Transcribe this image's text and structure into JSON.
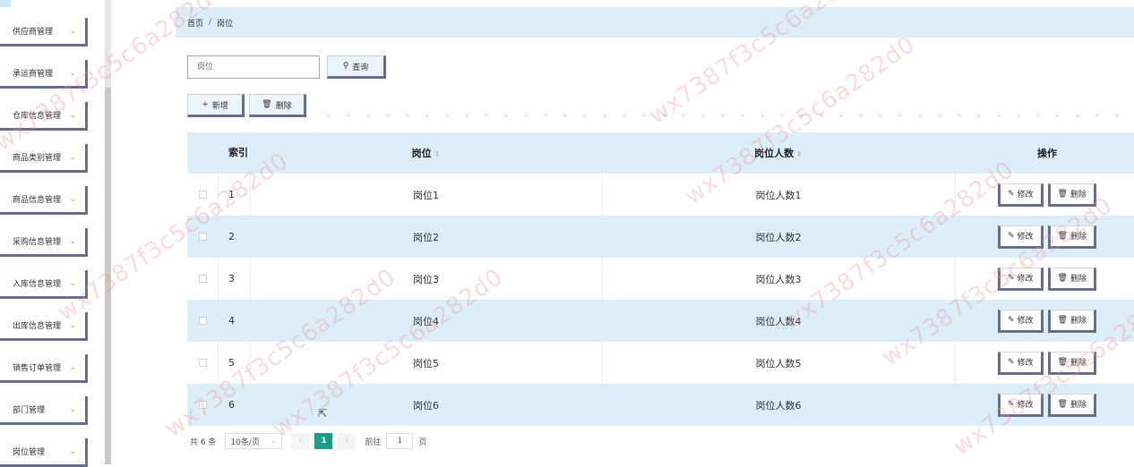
{
  "sidebar": {
    "items": [
      {
        "label": "供应商管理"
      },
      {
        "label": "承运商管理"
      },
      {
        "label": "仓库信息管理"
      },
      {
        "label": "商品类别管理"
      },
      {
        "label": "商品信息管理"
      },
      {
        "label": "采购信息管理"
      },
      {
        "label": "入库信息管理"
      },
      {
        "label": "出库信息管理"
      },
      {
        "label": "销售订单管理"
      },
      {
        "label": "部门管理"
      },
      {
        "label": "岗位管理"
      }
    ]
  },
  "breadcrumb": {
    "home": "首页",
    "separator": "/",
    "current": "岗位"
  },
  "search": {
    "placeholder": "岗位",
    "button_label": "查询",
    "button_icon": "search-icon"
  },
  "toolbar": {
    "add_label": "新增",
    "delete_label": "删除"
  },
  "table": {
    "columns": {
      "index": "索引",
      "position": "岗位",
      "count": "岗位人数",
      "actions": "操作"
    },
    "edit_label": "修改",
    "delete_label": "删除",
    "rows": [
      {
        "index": "1",
        "position": "岗位1",
        "count": "岗位人数1"
      },
      {
        "index": "2",
        "position": "岗位2",
        "count": "岗位人数2"
      },
      {
        "index": "3",
        "position": "岗位3",
        "count": "岗位人数3"
      },
      {
        "index": "4",
        "position": "岗位4",
        "count": "岗位人数4"
      },
      {
        "index": "5",
        "position": "岗位5",
        "count": "岗位人数5"
      },
      {
        "index": "6",
        "position": "岗位6",
        "count": "岗位人数6"
      }
    ]
  },
  "pagination": {
    "total": "共 6 条",
    "page_size": "10条/页",
    "current_page": "1",
    "goto_label": "前往",
    "goto_value": "1",
    "page_unit": "页"
  },
  "watermark": "wx7387f3c5c6a282d0",
  "colors": {
    "header_bg": "#dbeefa",
    "accent": "#1a9e8a",
    "button_border": "#6a6e8a"
  }
}
